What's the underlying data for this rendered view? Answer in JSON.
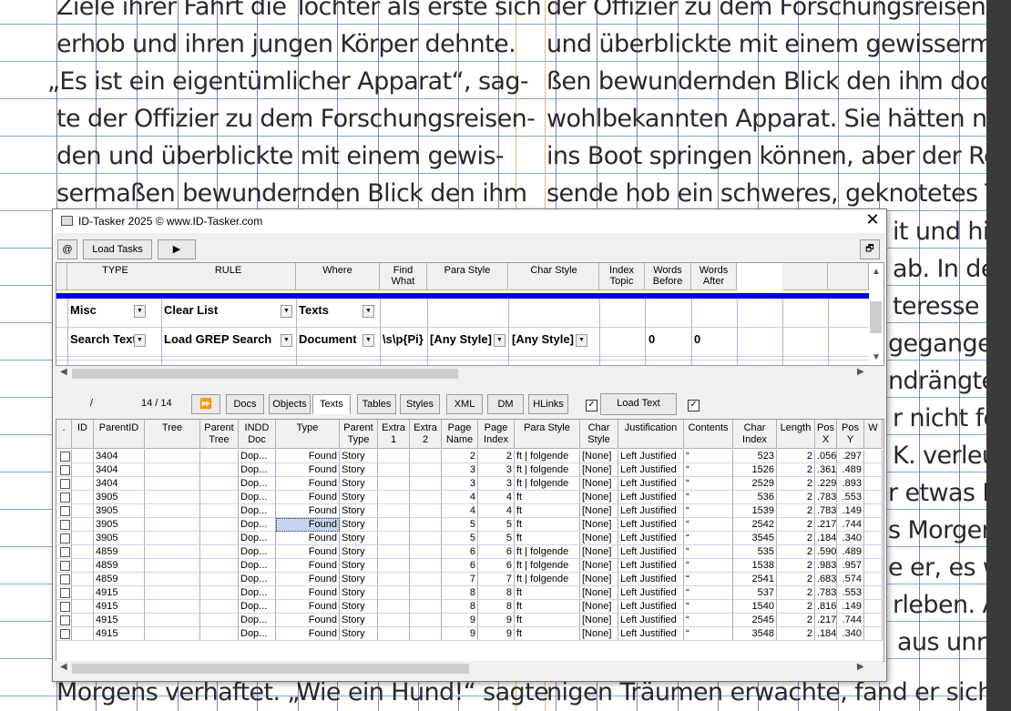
{
  "background_text": {
    "left": [
      "Ziele ihrer Fahrt die Tochter als erste sich",
      "erhob und ihren jungen Körper dehnte.",
      "„Es ist ein eigentümlicher Apparat“, sag-",
      "te der Offizier zu dem Forschungsreisen-",
      "den und überblickte mit einem gewis-",
      "sermaßen bewundernden Blick den ihm"
    ],
    "left_bottom": "Morgens verhaftet. „Wie ein Hund!“ sagte",
    "right": [
      "der Offizier zu dem Forschungsreisende",
      "und überblickte mit einem gewisserm",
      "ßen bewundernden Blick den ihm doc",
      "wohlbekannten Apparat. Sie hätten noc",
      "ins Boot springen können, aber der Re",
      "sende hob ein schweres, geknotetes Ta"
    ],
    "right_partial": [
      "it und hie",
      "ab. In de",
      "teresse a",
      "gegange",
      "ndrängte",
      "r nicht fo",
      "K. verleun",
      "r etwas B",
      "s Morgen",
      "e er, es wa",
      "rleben. A",
      "aus unr"
    ],
    "right_bottom": "nigen Träumen erwachte, fand er sich i"
  },
  "dialog": {
    "title": "ID-Tasker 2025  © www.ID-Tasker.com",
    "close_glyph": "✕",
    "toolbar": {
      "at_label": "@",
      "load_tasks_label": "Load Tasks",
      "play_glyph": "▶",
      "restore_glyph": "🗗"
    },
    "task_columns": [
      "TYPE",
      "RULE",
      "Where",
      "Find\nWhat",
      "Para Style",
      "Char Style",
      "Index\nTopic",
      "Words\nBefore",
      "Words\nAfter"
    ],
    "task_rows": [
      {
        "type": "Misc",
        "rule": "Clear List",
        "where": "Texts",
        "find": "",
        "para": "",
        "char": "",
        "index": "",
        "before": "",
        "after": ""
      },
      {
        "type": "Search Text",
        "rule": "Load GREP Search",
        "where": "Document",
        "find": "\\s\\p{Pi}",
        "para": "[Any Style]",
        "char": "[Any Style]",
        "index": "",
        "before": "0",
        "after": "0"
      }
    ],
    "results_bar": {
      "slash": "/",
      "count": "14 / 14",
      "ff_glyph": "⏩",
      "tabs": [
        "Docs",
        "Objects",
        "Texts",
        "Tables",
        "Styles",
        "XML",
        "DM",
        "HLinks"
      ],
      "active_tab": "Texts",
      "checkbox_left": "✓",
      "load_text_label": "Load Text",
      "checkbox_right": "✓"
    },
    "result_columns": [
      ".",
      "ID",
      "ParentID",
      "Tree",
      "Parent\nTree",
      "INDD\nDoc",
      "Type",
      "Parent\nType",
      "Extra\n1",
      "Extra\n2",
      "Page\nName",
      "Page\nIndex",
      "Para Style",
      "Char\nStyle",
      "Justification",
      "Contents",
      "Char\nIndex",
      "Length",
      "Pos\nX",
      "Pos\nY",
      "W"
    ],
    "result_rows": [
      {
        "parentid": "3404",
        "doc": "Dop...",
        "type": "Found",
        "ptype": "Story",
        "page": "2",
        "pindex": "2",
        "para": "ft | folgende",
        "char": "[None]",
        "just": "Left Justified",
        "contents": "“",
        "cindex": "523",
        "len": "2",
        "posx": ".056",
        "posy": ".297"
      },
      {
        "parentid": "3404",
        "doc": "Dop...",
        "type": "Found",
        "ptype": "Story",
        "page": "3",
        "pindex": "3",
        "para": "ft | folgende",
        "char": "[None]",
        "just": "Left Justified",
        "contents": "“",
        "cindex": "1526",
        "len": "2",
        "posx": ".361",
        "posy": ".489"
      },
      {
        "parentid": "3404",
        "doc": "Dop...",
        "type": "Found",
        "ptype": "Story",
        "page": "3",
        "pindex": "3",
        "para": "ft | folgende",
        "char": "[None]",
        "just": "Left Justified",
        "contents": "“",
        "cindex": "2529",
        "len": "2",
        "posx": ".229",
        "posy": ".893"
      },
      {
        "parentid": "3905",
        "doc": "Dop...",
        "type": "Found",
        "ptype": "Story",
        "page": "4",
        "pindex": "4",
        "para": "ft",
        "char": "[None]",
        "just": "Left Justified",
        "contents": "“",
        "cindex": "536",
        "len": "2",
        "posx": ".783",
        "posy": ".553"
      },
      {
        "parentid": "3905",
        "doc": "Dop...",
        "type": "Found",
        "ptype": "Story",
        "page": "4",
        "pindex": "4",
        "para": "ft",
        "char": "[None]",
        "just": "Left Justified",
        "contents": "“",
        "cindex": "1539",
        "len": "2",
        "posx": ".783",
        "posy": ".149"
      },
      {
        "parentid": "3905",
        "doc": "Dop...",
        "type": "Found",
        "ptype": "Story",
        "page": "5",
        "pindex": "5",
        "para": "ft",
        "char": "[None]",
        "just": "Left Justified",
        "contents": "“",
        "cindex": "2542",
        "len": "2",
        "posx": ".217",
        "posy": ".744"
      },
      {
        "parentid": "3905",
        "doc": "Dop...",
        "type": "Found",
        "ptype": "Story",
        "page": "5",
        "pindex": "5",
        "para": "ft",
        "char": "[None]",
        "just": "Left Justified",
        "contents": "“",
        "cindex": "3545",
        "len": "2",
        "posx": ".184",
        "posy": ".340"
      },
      {
        "parentid": "4859",
        "doc": "Dop...",
        "type": "Found",
        "ptype": "Story",
        "page": "6",
        "pindex": "6",
        "para": "ft | folgende",
        "char": "[None]",
        "just": "Left Justified",
        "contents": "“",
        "cindex": "535",
        "len": "2",
        "posx": ".590",
        "posy": ".489"
      },
      {
        "parentid": "4859",
        "doc": "Dop...",
        "type": "Found",
        "ptype": "Story",
        "page": "6",
        "pindex": "6",
        "para": "ft | folgende",
        "char": "[None]",
        "just": "Left Justified",
        "contents": "“",
        "cindex": "1538",
        "len": "2",
        "posx": ".983",
        "posy": ".957"
      },
      {
        "parentid": "4859",
        "doc": "Dop...",
        "type": "Found",
        "ptype": "Story",
        "page": "7",
        "pindex": "7",
        "para": "ft | folgende",
        "char": "[None]",
        "just": "Left Justified",
        "contents": "“",
        "cindex": "2541",
        "len": "2",
        "posx": ".683",
        "posy": ".574"
      },
      {
        "parentid": "4915",
        "doc": "Dop...",
        "type": "Found",
        "ptype": "Story",
        "page": "8",
        "pindex": "8",
        "para": "ft",
        "char": "[None]",
        "just": "Left Justified",
        "contents": "“",
        "cindex": "537",
        "len": "2",
        "posx": ".783",
        "posy": ".553"
      },
      {
        "parentid": "4915",
        "doc": "Dop...",
        "type": "Found",
        "ptype": "Story",
        "page": "8",
        "pindex": "8",
        "para": "ft",
        "char": "[None]",
        "just": "Left Justified",
        "contents": "“",
        "cindex": "1540",
        "len": "2",
        "posx": ".816",
        "posy": ".149"
      },
      {
        "parentid": "4915",
        "doc": "Dop...",
        "type": "Found",
        "ptype": "Story",
        "page": "9",
        "pindex": "9",
        "para": "ft",
        "char": "[None]",
        "just": "Left Justified",
        "contents": "“",
        "cindex": "2545",
        "len": "2",
        "posx": ".217",
        "posy": ".744"
      },
      {
        "parentid": "4915",
        "doc": "Dop...",
        "type": "Found",
        "ptype": "Story",
        "page": "9",
        "pindex": "9",
        "para": "ft",
        "char": "[None]",
        "just": "Left Justified",
        "contents": "“",
        "cindex": "3548",
        "len": "2",
        "posx": ".184",
        "posy": ".340"
      }
    ],
    "selected_row_index": 5,
    "selected_column": "type"
  },
  "colors": {
    "guide_blue": "#7fa9d6",
    "guide_purple": "#8f7bc0",
    "selection_band": "#0000e0",
    "selected_cell": "#c7d4f0"
  }
}
